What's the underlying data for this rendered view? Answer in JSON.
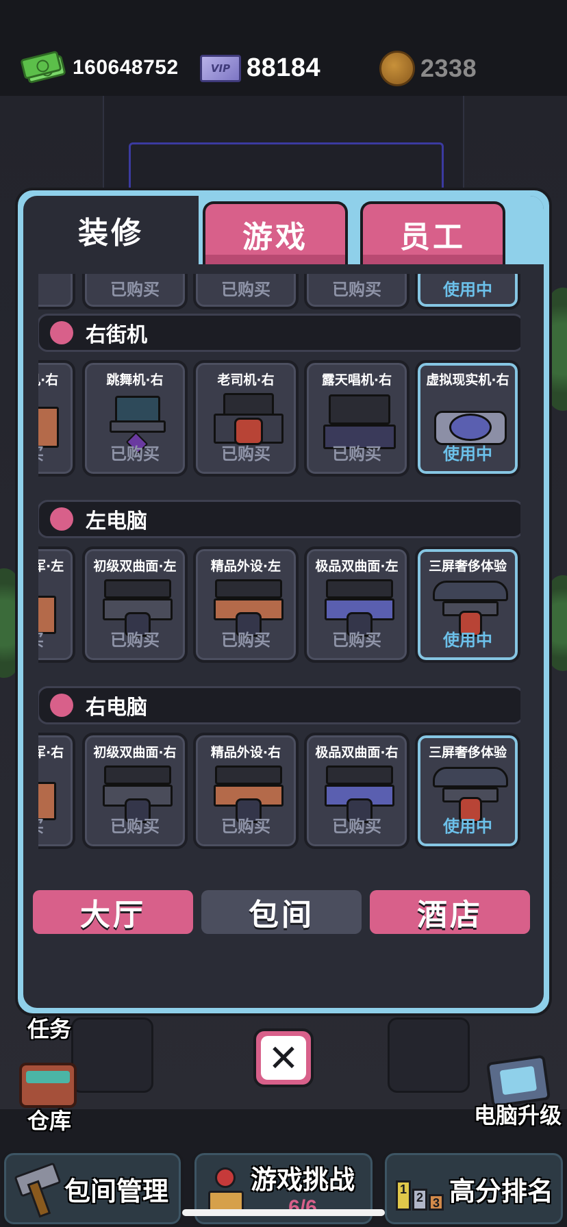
{
  "currency": {
    "cash": "160648752",
    "vip_badge": "VIP",
    "vip": "88184",
    "coins": "2338"
  },
  "dialog": {
    "tabs": [
      {
        "label": "装修",
        "active": true
      },
      {
        "label": "游戏",
        "active": false
      },
      {
        "label": "员工",
        "active": false
      }
    ],
    "top_row": {
      "statuses": [
        "买",
        "已购买",
        "已购买",
        "已购买",
        "使用中"
      ]
    },
    "sections": [
      {
        "title": "右街机",
        "items": [
          {
            "name": "机·右",
            "status": "买"
          },
          {
            "name": "跳舞机·右",
            "status": "已购买"
          },
          {
            "name": "老司机·右",
            "status": "已购买"
          },
          {
            "name": "露天唱机·右",
            "status": "已购买"
          },
          {
            "name": "虚拟现实机·右",
            "status": "使用中"
          }
        ]
      },
      {
        "title": "左电脑",
        "items": [
          {
            "name": "军·左",
            "status": "买"
          },
          {
            "name": "初级双曲面·左",
            "status": "已购买"
          },
          {
            "name": "精品外设·左",
            "status": "已购买"
          },
          {
            "name": "极品双曲面·左",
            "status": "已购买"
          },
          {
            "name": "三屏奢侈体验",
            "status": "使用中"
          }
        ]
      },
      {
        "title": "右电脑",
        "items": [
          {
            "name": "军·右",
            "status": "买"
          },
          {
            "name": "初级双曲面·右",
            "status": "已购买"
          },
          {
            "name": "精品外设·右",
            "status": "已购买"
          },
          {
            "name": "极品双曲面·右",
            "status": "已购买"
          },
          {
            "name": "三屏奢侈体验",
            "status": "使用中"
          }
        ]
      }
    ],
    "bottom_buttons": [
      {
        "label": "大厅",
        "style": "pink"
      },
      {
        "label": "包间",
        "style": "gray"
      },
      {
        "label": "酒店",
        "style": "pink"
      }
    ],
    "close_glyph": "✕"
  },
  "side": {
    "task_label": "任务",
    "warehouse_label": "仓库",
    "upgrade_label": "电脑升级"
  },
  "nav": {
    "room_manage": "包间管理",
    "game_challenge": "游戏挑战",
    "game_challenge_count": "6/6",
    "high_score": "高分排名",
    "podium_numbers": [
      "1",
      "2",
      "3"
    ]
  },
  "colors": {
    "accent_pink": "#d8608a",
    "dialog_frame": "#8fd0ea",
    "panel_bg": "#2a2c36",
    "in_use_blue": "#6cc1ea"
  }
}
